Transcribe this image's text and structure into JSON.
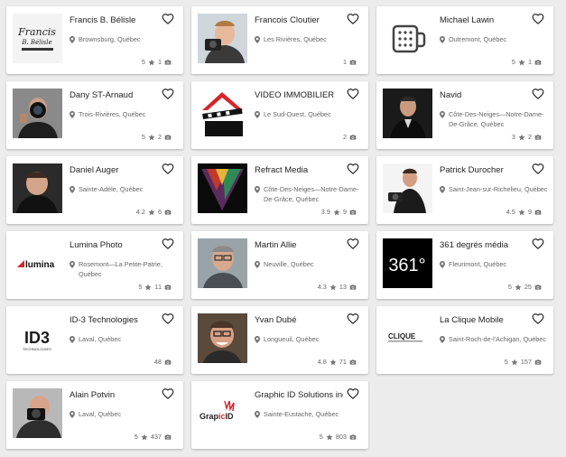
{
  "cards": [
    {
      "name": "Francis B. Bélisle",
      "location": "Brownsburg, Québec",
      "rating": "5",
      "photos": "1",
      "thumb": "logo-francis"
    },
    {
      "name": "Francois Cloutier",
      "location": "Les Rivières, Québec",
      "rating": "",
      "photos": "1",
      "thumb": "person-camera"
    },
    {
      "name": "Michael Lawin",
      "location": "Outremont, Québec",
      "rating": "5",
      "photos": "1",
      "thumb": "camera-icon-placeholder"
    },
    {
      "name": "Dany ST-Arnaud",
      "location": "Trois-Rivières, Québec",
      "rating": "5",
      "photos": "2",
      "thumb": "person-lens"
    },
    {
      "name": "VIDEO IMMOBILIER",
      "location": "Le Sud-Ouest, Québec",
      "rating": "",
      "photos": "2",
      "thumb": "logo-video-immobilier"
    },
    {
      "name": "Navid",
      "location": "Côte-Des-Neiges—Notre-Dame-De-Grâce, Québec",
      "rating": "3",
      "photos": "2",
      "thumb": "person-navid"
    },
    {
      "name": "Daniel Auger",
      "location": "Sainte-Adèle, Québec",
      "rating": "4.2",
      "photos": "6",
      "thumb": "person-daniel"
    },
    {
      "name": "Refract Media",
      "location": "Côte-Des-Neiges—Notre-Dame-De-Grâce, Québec",
      "rating": "3.9",
      "photos": "9",
      "thumb": "logo-refract"
    },
    {
      "name": "Patrick Durocher",
      "location": "Saint-Jean-sur-Richelieu, Québec",
      "rating": "4.5",
      "photos": "9",
      "thumb": "person-patrick"
    },
    {
      "name": "Lumina Photo",
      "location": "Rosemont—La Petite-Patrie, Québec",
      "rating": "5",
      "photos": "11",
      "thumb": "logo-lumina"
    },
    {
      "name": "Martin Allie",
      "location": "Neuville, Québec",
      "rating": "4.3",
      "photos": "13",
      "thumb": "person-martin"
    },
    {
      "name": "361 degrés média",
      "location": "Fleurimont, Québec",
      "rating": "5",
      "photos": "25",
      "thumb": "logo-361"
    },
    {
      "name": "ID-3 Technologies",
      "location": "Laval, Québec",
      "rating": "",
      "photos": "48",
      "thumb": "logo-id3"
    },
    {
      "name": "Yvan Dubé",
      "location": "Longueuil, Québec",
      "rating": "4.8",
      "photos": "71",
      "thumb": "person-yvan"
    },
    {
      "name": "La Clique Mobile",
      "location": "Saint-Roch-de-l'Achigan, Québec",
      "rating": "5",
      "photos": "157",
      "thumb": "logo-laclique"
    },
    {
      "name": "Alain Potvin",
      "location": "Laval, Québec",
      "rating": "5",
      "photos": "437",
      "thumb": "person-alain"
    },
    {
      "name": "Graphic ID Solutions inc",
      "location": "Sainte-Eustache, Québec",
      "rating": "5",
      "photos": "803",
      "thumb": "logo-graphicid"
    }
  ],
  "logo_text": {
    "francis_line1": "Francis",
    "francis_line2": "B. Bélisle",
    "lumina": "lumina",
    "d361": "361°",
    "id3": "ID3",
    "id3_sub": "TECHNOLOGIES",
    "laclique": "CLIQUE",
    "graphicid_a": "Grap",
    "graphicid_b": "ic",
    "graphicid_c": "ID"
  },
  "colors": {
    "background": "#ececec",
    "card": "#ffffff",
    "icon_gray": "#757575",
    "heart": "#222222"
  }
}
